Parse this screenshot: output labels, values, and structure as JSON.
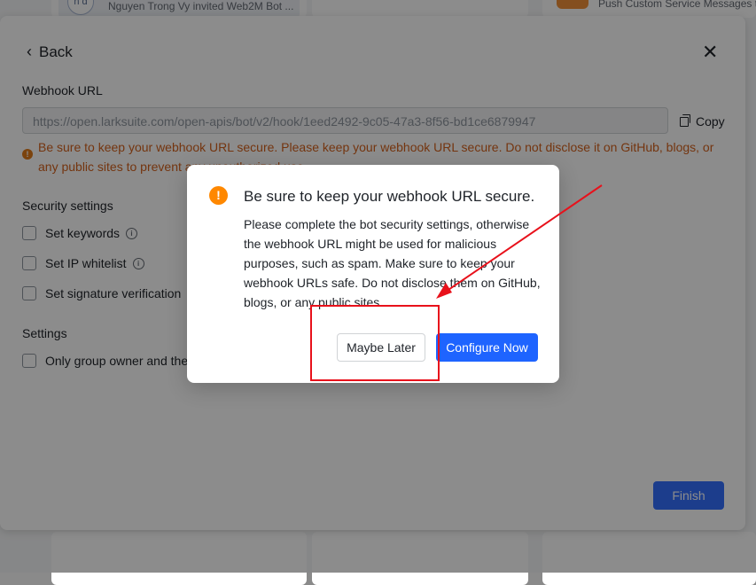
{
  "background": {
    "invite_avatar": "n d",
    "invite_text": "Nguyen Trong Vy invited Web2M Bot ...",
    "right_text": "Push Custom Service Messages to"
  },
  "panel": {
    "back_label": "Back",
    "webhook_label": "Webhook URL",
    "webhook_url": "https://open.larksuite.com/open-apis/bot/v2/hook/1eed2492-9c05-47a3-8f56-bd1ce6879947",
    "copy_label": "Copy",
    "warning": "Be sure to keep your webhook URL secure. Please keep your webhook URL secure. Do not disclose it on GitHub, blogs, or any public sites to prevent any unauthorized use.",
    "security_heading": "Security settings",
    "security_options": [
      {
        "label": "Set keywords"
      },
      {
        "label": "Set IP whitelist"
      },
      {
        "label": "Set signature verification"
      }
    ],
    "settings_heading": "Settings",
    "settings_options": [
      {
        "label": "Only group owner and the"
      }
    ],
    "finish_label": "Finish"
  },
  "modal": {
    "title": "Be sure to keep your webhook URL secure.",
    "body": "Please complete the bot security settings, otherwise the webhook URL might be used for malicious purposes, such as spam. Make sure to keep your webhook URLs safe. Do not disclose them on GitHub, blogs, or any public sites.",
    "later_label": "Maybe Later",
    "configure_label": "Configure Now"
  },
  "colors": {
    "primary": "#1e64ff",
    "warning_text": "#d4621d",
    "warning_icon": "#ff8800",
    "annotation": "#e8111b"
  }
}
